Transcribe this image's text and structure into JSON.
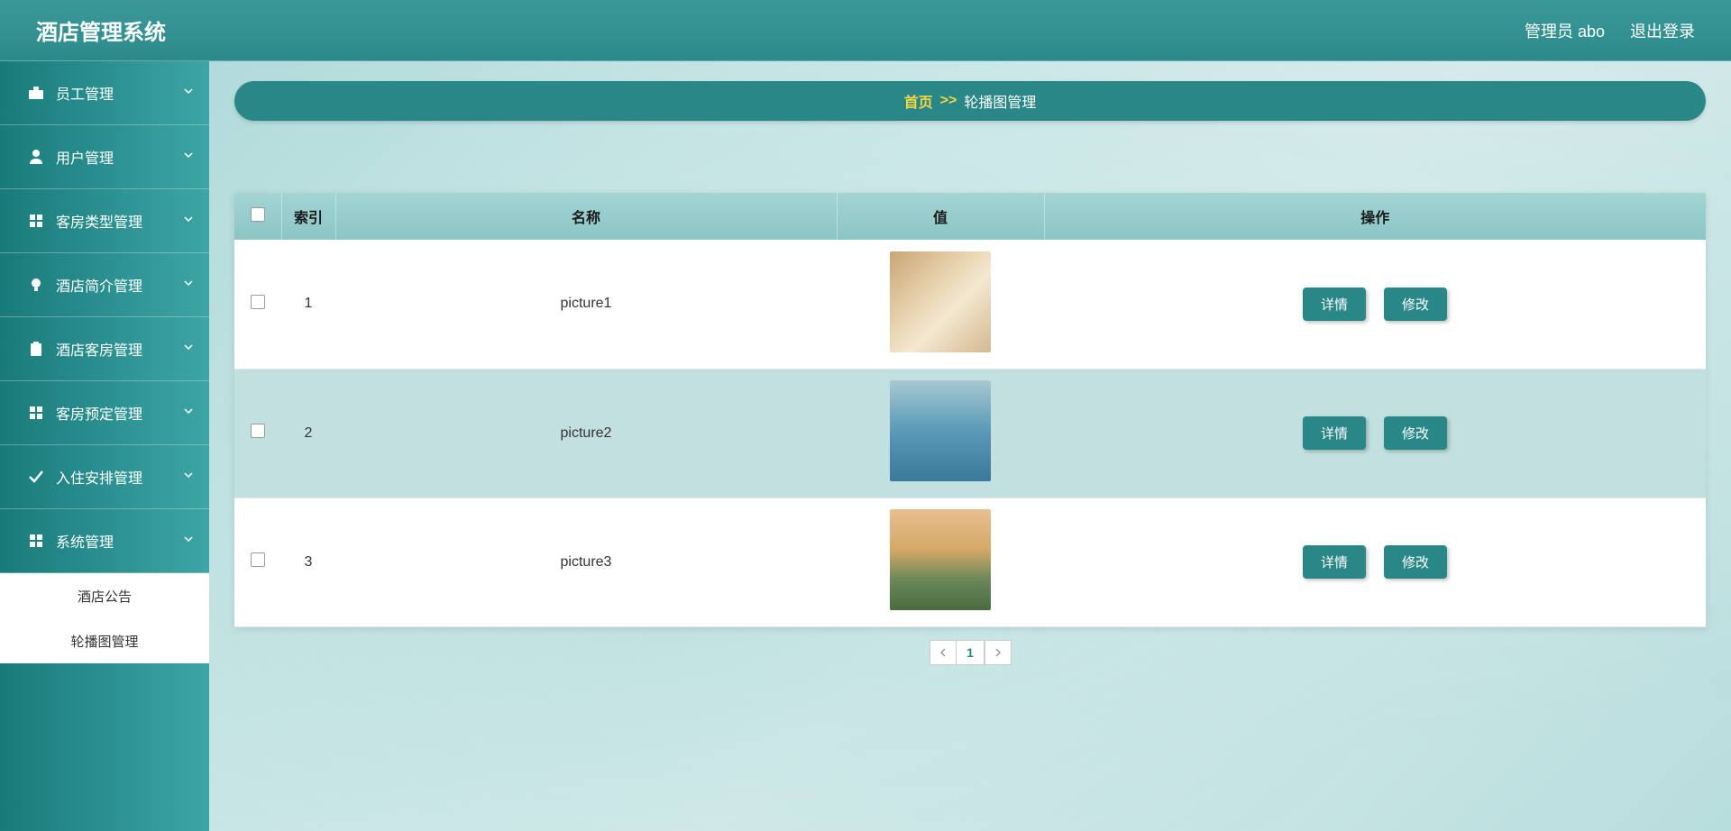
{
  "header": {
    "title": "酒店管理系统",
    "user_label": "管理员 abo",
    "logout_label": "退出登录"
  },
  "sidebar": {
    "items": [
      {
        "label": "员工管理",
        "icon": "briefcase"
      },
      {
        "label": "用户管理",
        "icon": "user"
      },
      {
        "label": "客房类型管理",
        "icon": "grid"
      },
      {
        "label": "酒店简介管理",
        "icon": "bulb"
      },
      {
        "label": "酒店客房管理",
        "icon": "clipboard"
      },
      {
        "label": "客房预定管理",
        "icon": "grid"
      },
      {
        "label": "入住安排管理",
        "icon": "check"
      },
      {
        "label": "系统管理",
        "icon": "grid"
      }
    ],
    "submenu": [
      {
        "label": "酒店公告"
      },
      {
        "label": "轮播图管理"
      }
    ]
  },
  "breadcrumb": {
    "home": "首页",
    "sep": ">>",
    "current": "轮播图管理"
  },
  "table": {
    "headers": {
      "index": "索引",
      "name": "名称",
      "value": "值",
      "action": "操作"
    },
    "rows": [
      {
        "index": "1",
        "name": "picture1"
      },
      {
        "index": "2",
        "name": "picture2"
      },
      {
        "index": "3",
        "name": "picture3"
      }
    ],
    "detail_btn": "详情",
    "edit_btn": "修改"
  },
  "pagination": {
    "current": "1"
  }
}
